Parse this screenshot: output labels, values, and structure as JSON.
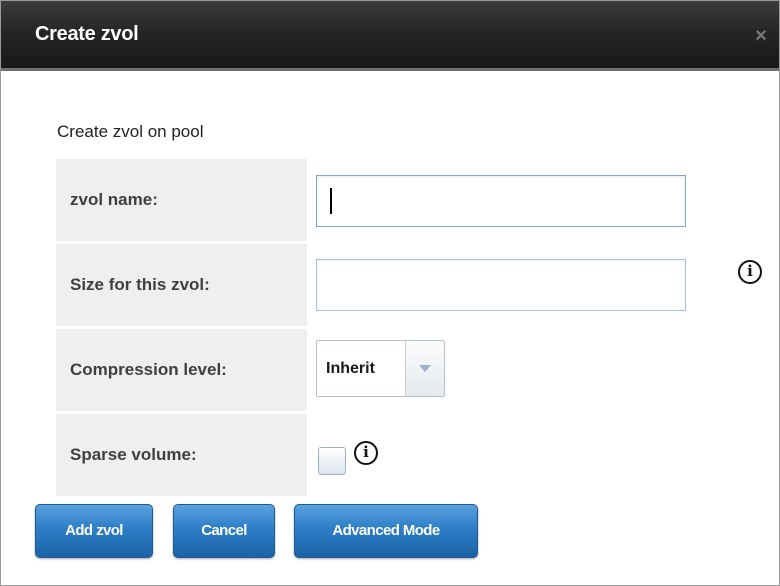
{
  "dialog": {
    "title": "Create zvol",
    "close_icon": "×"
  },
  "form": {
    "heading": "Create zvol on pool",
    "zvol_name": {
      "label": "zvol name:",
      "value": ""
    },
    "size": {
      "label": "Size for this zvol:",
      "value": ""
    },
    "compression": {
      "label": "Compression level:",
      "selected": "Inherit"
    },
    "sparse": {
      "label": "Sparse volume:",
      "checked": false
    },
    "info_glyph": "i"
  },
  "buttons": {
    "add": "Add zvol",
    "cancel": "Cancel",
    "advanced": "Advanced Mode"
  },
  "colors": {
    "titlebar": "#1f1f1f",
    "button_blue": "#2d7ec7",
    "label_bg": "#efefef"
  }
}
